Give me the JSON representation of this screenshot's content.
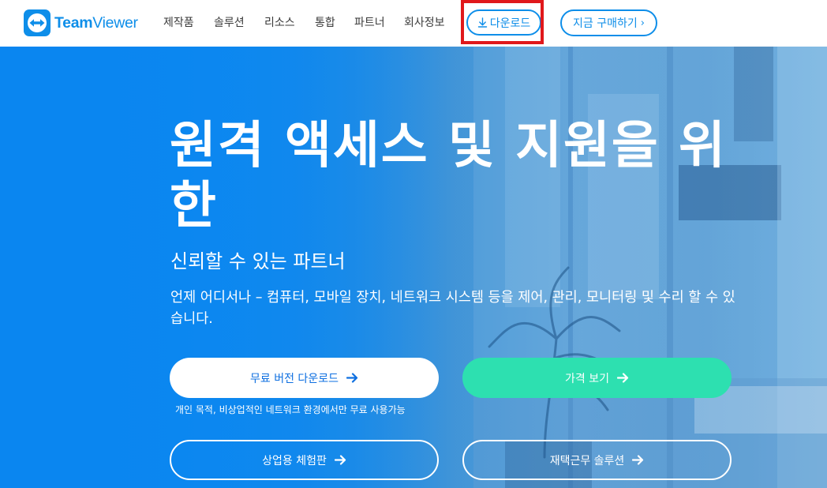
{
  "header": {
    "logo": {
      "brand_bold": "Team",
      "brand_thin": "Viewer"
    },
    "nav": [
      {
        "label": "제작품"
      },
      {
        "label": "솔루션"
      },
      {
        "label": "리소스"
      },
      {
        "label": "통합"
      },
      {
        "label": "파트너"
      },
      {
        "label": "회사정보"
      }
    ],
    "download_label": "다운로드",
    "buy_label": "지금 구매하기",
    "buy_chevron": "›"
  },
  "hero": {
    "title": "원격 액세스 및 지원을 위한",
    "subtitle": "신뢰할 수 있는 파트너",
    "description": "언제 어디서나 – 컴퓨터, 모바일 장치, 네트워크 시스템 등을 제어, 관리, 모니터링 및 수리 할 수 있습니다.",
    "buttons": {
      "free_download": "무료 버전 다운로드",
      "pricing": "가격 보기",
      "business_trial": "상업용 체험판",
      "remote_work": "재택근무 솔루션"
    },
    "free_note": "개인 목적, 비상업적인 네트워크 환경에서만 무료 사용가능"
  },
  "colors": {
    "brand_blue": "#0e8ee9",
    "hero_blue": "#0a86f0",
    "pricing_green": "#2de0b0",
    "highlight_red": "#e0181b"
  },
  "icons": {
    "logo": "teamviewer-logo-icon",
    "download": "download-arrow-icon",
    "arrow": "arrow-right-icon"
  }
}
